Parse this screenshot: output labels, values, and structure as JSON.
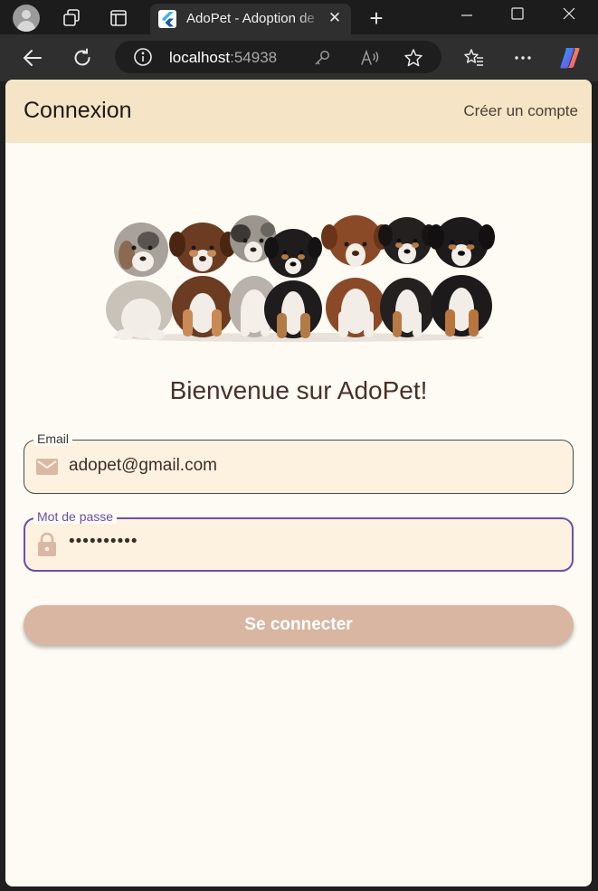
{
  "browser": {
    "tab_title": "AdoPet - Adoption de",
    "tab_close_glyph": "✕",
    "new_tab_glyph": "+",
    "address": {
      "host": "localhost",
      "port": ":54938"
    }
  },
  "appbar": {
    "title": "Connexion",
    "action": "Créer un compte"
  },
  "main": {
    "welcome": "Bienvenue sur AdoPet!",
    "email": {
      "label": "Email",
      "value": "adopet@gmail.com"
    },
    "password": {
      "label": "Mot de passe",
      "value": "••••••••••"
    },
    "login_button": "Se connecter"
  },
  "colors": {
    "appbar_bg": "#f5e4c5",
    "page_bg": "#fefaf4",
    "field_bg": "#fdf2e0",
    "focus_border": "#6c4ea8",
    "button_bg": "#d8b6a2",
    "title_text": "#4a3128",
    "field_icon": "#d9b8a5"
  },
  "icons": {
    "email_field": "mail-icon",
    "password_field": "lock-icon"
  }
}
